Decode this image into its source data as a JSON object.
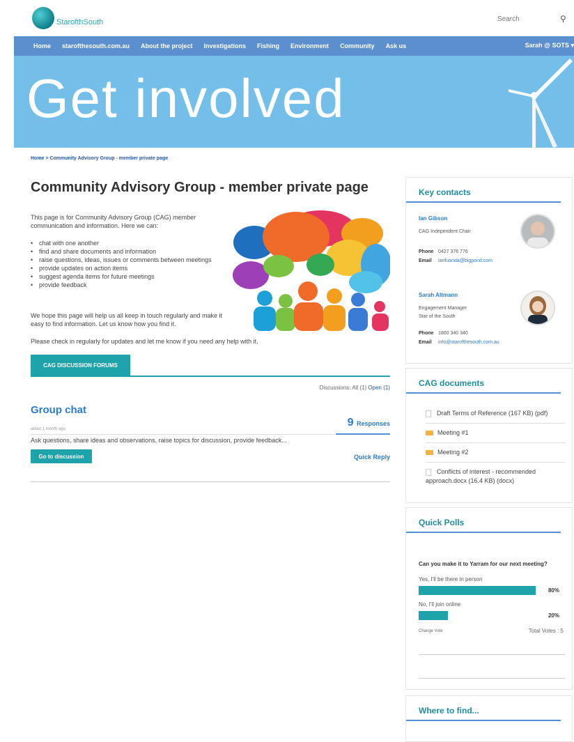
{
  "header": {
    "logo_text": "StarofthSouth",
    "search_placeholder": "Search",
    "nav": [
      "Home",
      "starofthesouth.com.au",
      "About the project",
      "Investigations",
      "Fishing",
      "Environment",
      "Community",
      "Ask us"
    ],
    "user": "Sarah @ SOTS"
  },
  "hero": {
    "title": "Get involved"
  },
  "breadcrumb": "Home  >  Community Advisory Group - member private page",
  "main": {
    "title": "Community Advisory Group - member private page",
    "intro": "This page is for Community Advisory Group (CAG) member communication and information. Here we can:",
    "bullets": [
      "chat with one another",
      "find and share documents and information",
      "raise questions, ideas, issues or comments between meetings",
      "provide updates on action items",
      "suggest agenda items for future meetings",
      "provide feedback"
    ],
    "hope": "We hope this page will help us all keep in touch regularly and make it easy to find information. Let us know how you find it.",
    "checkin": "Please check in regularly for updates and let me know if you need any help with it.",
    "tab_label": "CAG DISCUSSION FORUMS",
    "filter_label": "Discussions:",
    "filter_all": "All (1)",
    "filter_open": "Open (1)",
    "thread": {
      "title": "Group chat",
      "meta": "about 1 month ago",
      "responses_count": "9",
      "responses_label": "Responses",
      "description": "Ask questions, share ideas and observations, raise topics for discussion, provide feedback...",
      "go_label": "Go to discussion",
      "quick_reply": "Quick Reply"
    }
  },
  "sidebar": {
    "contacts": {
      "heading": "Key contacts",
      "people": [
        {
          "name": "Ian Gibson",
          "role": "CAG Independent Chair",
          "org": "",
          "phone_label": "Phone",
          "phone": "0427 376 776",
          "email_label": "Email",
          "email": "ianfuanda@bigpond.com"
        },
        {
          "name": "Sarah Altmann",
          "role": "Engagement Manager",
          "org": "Star of the South",
          "phone_label": "Phone",
          "phone": "1800 340 340",
          "email_label": "Email",
          "email": "info@starofthesouth.com.au"
        }
      ]
    },
    "documents": {
      "heading": "CAG documents",
      "items": [
        "Draft Terms of Reference (167 KB) (pdf)",
        "Meeting #1",
        "Meeting #2",
        "Conflicts of interest - recommended approach.docx (16.4 KB) (docx)"
      ]
    },
    "polls": {
      "heading": "Quick Polls",
      "question": "Can you make it to Yarram for our next meeting?",
      "options": [
        {
          "label": "Yes, I'll be there in person",
          "pct": "80%",
          "value": 0.8
        },
        {
          "label": "No, I'll join online",
          "pct": "20%",
          "value": 0.2
        }
      ],
      "change_vote": "Change Vote",
      "total": "Total Votes : 5"
    },
    "where": {
      "heading": "Where to find..."
    }
  },
  "colors": {
    "brand_teal": "#1fa3aa",
    "nav_blue": "#5c8fce",
    "hero_blue": "#74bfea",
    "link_blue": "#2a7bd0"
  }
}
